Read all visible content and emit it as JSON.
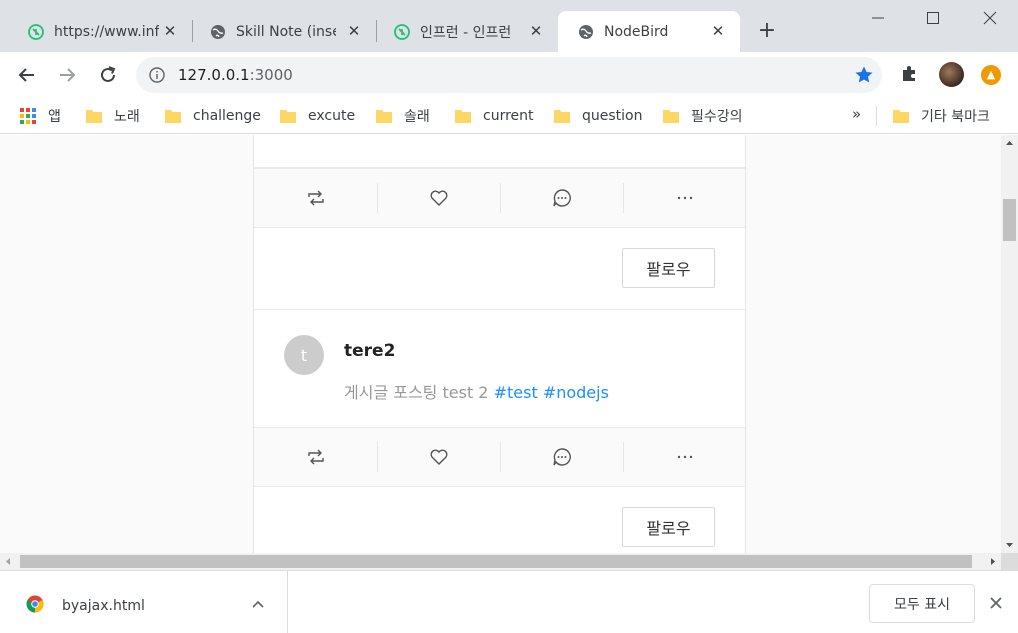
{
  "tabs": [
    {
      "title": "https://www.inf",
      "icon": "inflearn-icon"
    },
    {
      "title": "Skill Note (inse",
      "icon": "globe-icon"
    },
    {
      "title": "인프런 - 인프런",
      "icon": "inflearn-icon"
    },
    {
      "title": "NodeBird",
      "icon": "globe-icon",
      "active": true
    }
  ],
  "toolbar": {
    "url_host": "127.0.0.1",
    "url_port": ":3000"
  },
  "bookmarks": {
    "apps_label": "앱",
    "items": [
      "노래",
      "challenge",
      "excute",
      "솔래",
      "current",
      "question",
      "필수강의"
    ],
    "more_label": "»",
    "other_label": "기타 북마크"
  },
  "feed": {
    "follow_label": "팔로우",
    "post": {
      "avatar_letter": "t",
      "author": "tere2",
      "text": "게시글 포스팅 test 2 ",
      "tags": [
        "#test",
        "#nodejs"
      ]
    }
  },
  "downloads": {
    "file_name": "byajax.html",
    "show_all_label": "모두 표시"
  },
  "colors": {
    "accent_blue": "#1a73e8",
    "hashtag_blue": "#1890ff",
    "inflearn_green": "#1dc078"
  }
}
